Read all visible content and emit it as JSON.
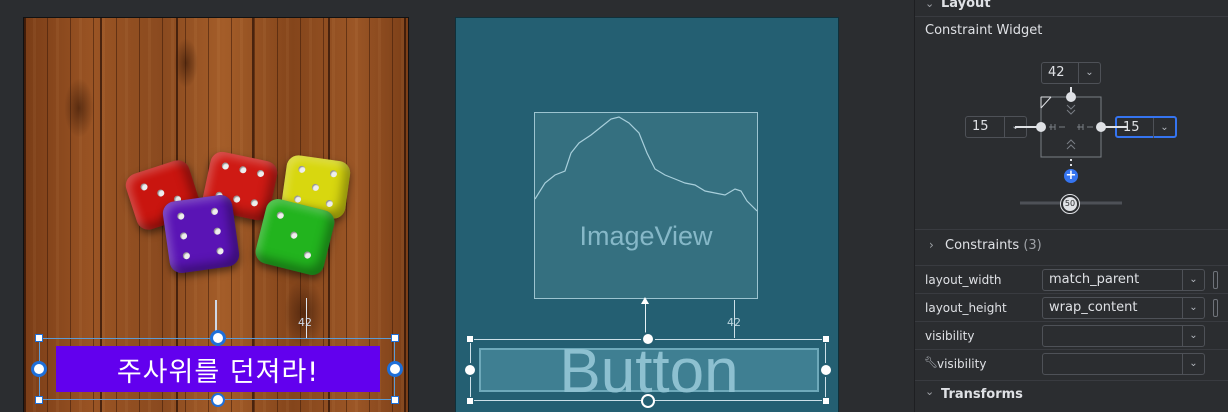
{
  "design_view": {
    "button_text": "주사위를 던져라!",
    "margin_label": "42"
  },
  "blueprint_view": {
    "imageview_label": "ImageView",
    "button_label": "Button",
    "margin_label": "42"
  },
  "panel": {
    "layout_section": "Layout",
    "constraint_widget_title": "Constraint Widget",
    "top_margin": "42",
    "left_margin": "15",
    "right_margin": "15",
    "bias_value": "50",
    "constraints_label": "Constraints",
    "constraints_count": "(3)",
    "properties": [
      {
        "label": "layout_width",
        "value": "match_parent"
      },
      {
        "label": "layout_height",
        "value": "wrap_content"
      },
      {
        "label": "visibility",
        "value": ""
      },
      {
        "label": "visibility",
        "value": ""
      }
    ],
    "transforms_section": "Transforms"
  },
  "colors": {
    "button_purple": "#6200ee",
    "blueprint_bg": "#245f72",
    "selection_blue": "#1e6fd9",
    "panel_bg": "#2b2d30",
    "focus_blue": "#3574f0"
  },
  "icons": [
    "chevron-down-icon",
    "chevron-right-icon",
    "add-constraint-icon",
    "wrench-icon"
  ]
}
